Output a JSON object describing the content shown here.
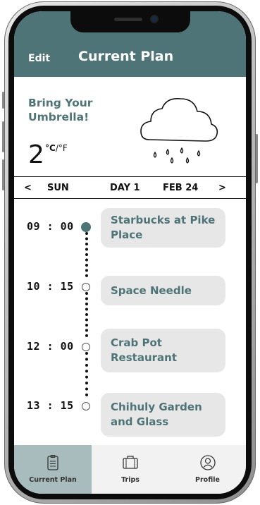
{
  "header": {
    "edit_label": "Edit",
    "title": "Current Plan"
  },
  "weather": {
    "message": "Bring Your Umbrella!",
    "temperature": "2",
    "unit_c": "°C",
    "unit_sep": "/",
    "unit_f": "°F",
    "icon": "rain-cloud-icon"
  },
  "day_nav": {
    "prev": "<",
    "day": "SUN",
    "day_number": "DAY 1",
    "date": "FEB 24",
    "next": ">"
  },
  "timeline": [
    {
      "time": "09 : 00",
      "place": "Starbucks at Pike Place",
      "active": true
    },
    {
      "time": "10 : 15",
      "place": "Space Needle",
      "active": false
    },
    {
      "time": "12 : 00",
      "place": "Crab Pot Restaurant",
      "active": false
    },
    {
      "time": "13 : 15",
      "place": "Chihuly Garden and Glass",
      "active": false
    }
  ],
  "tabs": [
    {
      "label": "Current Plan",
      "icon": "document-icon",
      "active": true
    },
    {
      "label": "Trips",
      "icon": "suitcase-icon",
      "active": false
    },
    {
      "label": "Profile",
      "icon": "profile-icon",
      "active": false
    }
  ],
  "colors": {
    "accent": "#4f7477",
    "card": "#e7e7e7",
    "active_tab": "#a8bcbd"
  }
}
